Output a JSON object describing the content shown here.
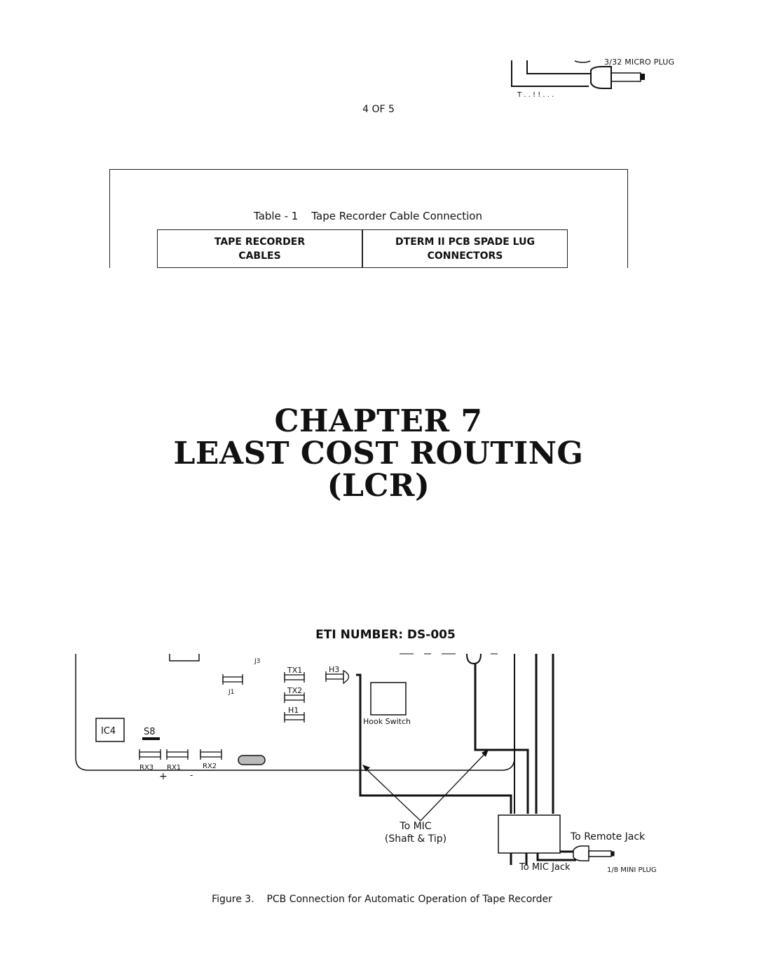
{
  "page": {
    "page_number": "4 OF 5"
  },
  "top_fragment": {
    "plug_label": "3/32 MICRO PLUG"
  },
  "table": {
    "caption": "Table - 1    Tape Recorder Cable Connection",
    "headers": [
      {
        "line1": "TAPE RECORDER",
        "line2": "CABLES"
      },
      {
        "line1": "DTERM II PCB SPADE LUG",
        "line2": "CONNECTORS"
      }
    ]
  },
  "chapter": {
    "line1": "CHAPTER 7",
    "line2": "LEAST COST ROUTING",
    "line3": "(LCR)"
  },
  "figure": {
    "eti_number": "ETI NUMBER: DS-005",
    "labels": {
      "j3": "J3",
      "j1": "J1",
      "tx1": "TX1",
      "tx2": "TX2",
      "h1": "H1",
      "h3": "H3",
      "ic4": "IC4",
      "s8": "S8",
      "rx3": "RX3",
      "rx1": "RX1",
      "rx2": "RX2",
      "plus": "+",
      "minus": "-",
      "hook_switch": "Hook Switch",
      "to_mic_line1": "To MIC",
      "to_mic_line2": "(Shaft & Tip)",
      "to_remote_jack": "To Remote Jack",
      "to_mic_jack": "To MIC Jack",
      "mini_plug": "1/8 MINI PLUG"
    },
    "caption": "Figure 3.    PCB Connection for Automatic Operation of Tape Recorder"
  }
}
